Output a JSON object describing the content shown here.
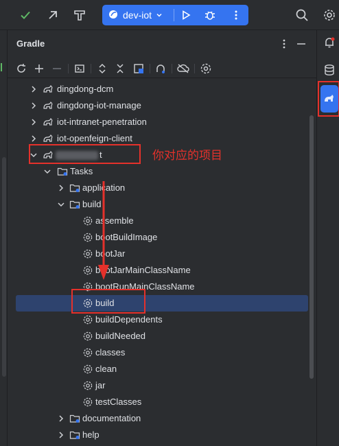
{
  "toolbar": {
    "run_config_label": "dev-iot",
    "icons": [
      "check-icon",
      "arrow-up-right-icon",
      "hammer-icon",
      "spring-leaf-icon",
      "chevron-down-icon",
      "run-icon",
      "debug-icon",
      "more-icon",
      "search-icon",
      "settings-icon"
    ]
  },
  "panel": {
    "title": "Gradle",
    "header_icons": [
      "more-vertical-icon",
      "minimize-icon"
    ],
    "toolbar_icons": [
      "reload-icon",
      "add-icon",
      "remove-icon",
      "execute-task-icon",
      "expand-all-icon",
      "collapse-all-icon",
      "analyze-dependencies-icon",
      "toggle-offline-icon",
      "offline-mode-icon",
      "gradle-settings-icon"
    ]
  },
  "right_strip_icons": [
    "notifications-icon",
    "database-icon",
    "gradle-tool-icon"
  ],
  "tree": {
    "projects": [
      {
        "label": "dingdong-dcm"
      },
      {
        "label": "dingdong-iot-manage"
      },
      {
        "label": "iot-intranet-penetration"
      },
      {
        "label": "iot-openfeign-client"
      },
      {
        "label": "t"
      }
    ],
    "tasks_label": "Tasks",
    "groups": [
      {
        "label": "application"
      },
      {
        "label": "build"
      },
      {
        "label": "documentation"
      },
      {
        "label": "help"
      }
    ],
    "build_tasks": [
      {
        "label": "assemble"
      },
      {
        "label": "bootBuildImage"
      },
      {
        "label": "bootJar"
      },
      {
        "label": "bootJarMainClassName"
      },
      {
        "label": "bootRunMainClassName"
      },
      {
        "label": "build"
      },
      {
        "label": "buildDependents"
      },
      {
        "label": "buildNeeded"
      },
      {
        "label": "classes"
      },
      {
        "label": "clean"
      },
      {
        "label": "jar"
      },
      {
        "label": "testClasses"
      }
    ]
  },
  "annotation": {
    "note": "你对应的项目",
    "color": "#e5312b"
  },
  "colors": {
    "accent": "#3574f0",
    "selection": "#2e436e",
    "background": "#2b2d30",
    "text": "#dfe1e5"
  }
}
